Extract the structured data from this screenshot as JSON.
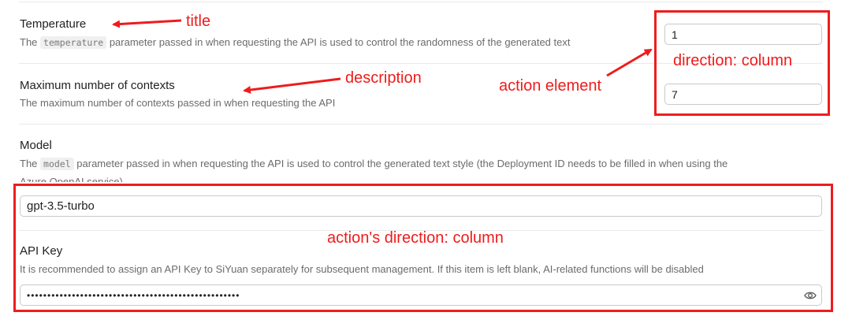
{
  "settings": {
    "temperature": {
      "title": "Temperature",
      "desc_prefix": "The",
      "code": "temperature",
      "desc_suffix": "parameter passed in when requesting the API is used to control the randomness of the generated text",
      "value": "1"
    },
    "max_contexts": {
      "title": "Maximum number of contexts",
      "desc": "The maximum number of contexts passed in when requesting the API",
      "value": "7"
    },
    "model": {
      "title": "Model",
      "desc_prefix": "The",
      "code": "model",
      "desc_suffix": "parameter passed in when requesting the API is used to control the generated text style (the Deployment ID needs to be filled in when using the",
      "desc_line2": "Azure OpenAI service)",
      "value": "gpt-3.5-turbo"
    },
    "api_key": {
      "title": "API Key",
      "desc": "It is recommended to assign an API Key to SiYuan separately for subsequent management. If this item is left blank, AI-related functions will be disabled",
      "value": "••••••••••••••••••••••••••••••••••••••••••••••••••••",
      "eye_icon": "eye-icon"
    }
  },
  "annotations": {
    "title": "title",
    "description": "description",
    "action_element": "action element",
    "direction_column": "direction: column",
    "actions_direction_column": "action's direction: column",
    "color": "#ee1c1c"
  }
}
